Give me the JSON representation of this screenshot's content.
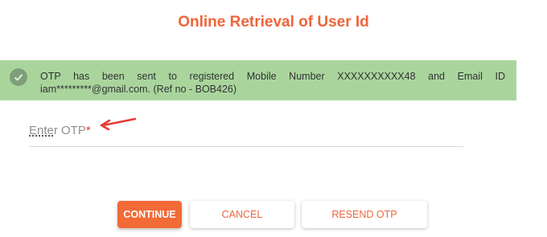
{
  "page": {
    "title": "Online Retrieval of User Id"
  },
  "alert": {
    "icon": "check-circle-icon",
    "message": "OTP has been sent to registered Mobile Number XXXXXXXXXX48 and Email ID iam*********@gmail.com. (Ref no - BOB426)",
    "background": "#a9d59d"
  },
  "otp": {
    "label": "Enter OTP",
    "required_marker": "*",
    "value": ""
  },
  "annotation": {
    "icon": "red-arrow-icon",
    "color": "#e53935"
  },
  "buttons": {
    "continue_label": "CONTINUE",
    "cancel_label": "CANCEL",
    "resend_label": "RESEND OTP"
  },
  "colors": {
    "accent": "#f0643a",
    "primary_button": "#f26a36"
  }
}
